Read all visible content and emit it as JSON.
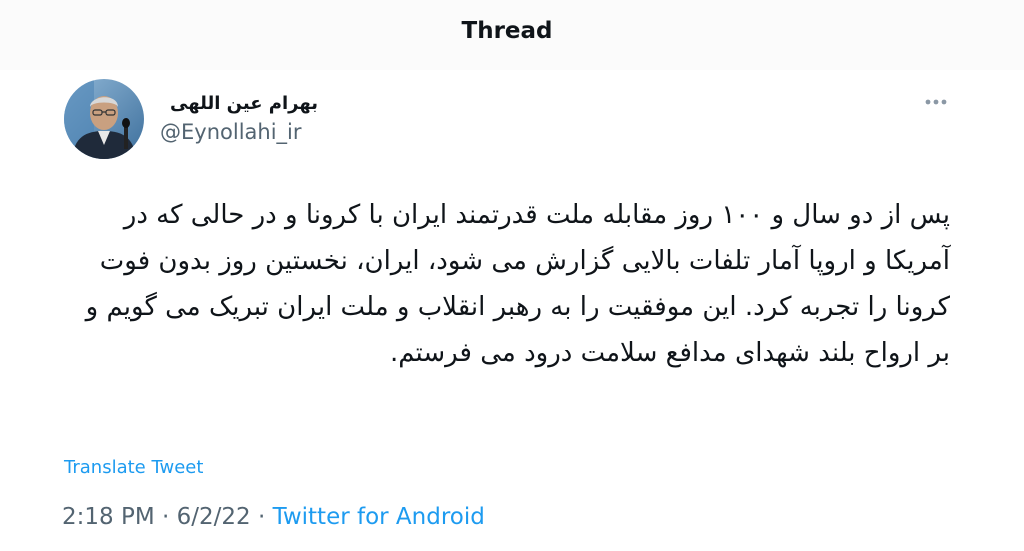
{
  "header": {
    "title": "Thread"
  },
  "author": {
    "display_name": "بهرام عین اللهی",
    "handle": "@Eynollahi_ir",
    "avatar_icon": "person-avatar-icon"
  },
  "tweet": {
    "text": "پس از دو سال و ۱۰۰ روز مقابله ملت قدرتمند ایران با کرونا و در حالی که در آمریکا و اروپا آمار تلفات بالایی گزارش می شود، ایران، نخستین روز بدون فوت کرونا  را تجربه کرد. این موفقیت را به رهبر انقلاب و ملت ایران تبریک می گویم و بر ارواح بلند شهدای مدافع سلامت درود می فرستم.",
    "translate_label": "Translate Tweet",
    "time": "2:18 PM",
    "separator1": " · ",
    "date": "6/2/22",
    "separator2": " · ",
    "source": "Twitter for Android"
  },
  "colors": {
    "text_primary": "#0f1419",
    "text_secondary": "#536471",
    "link": "#1d9bf0"
  }
}
